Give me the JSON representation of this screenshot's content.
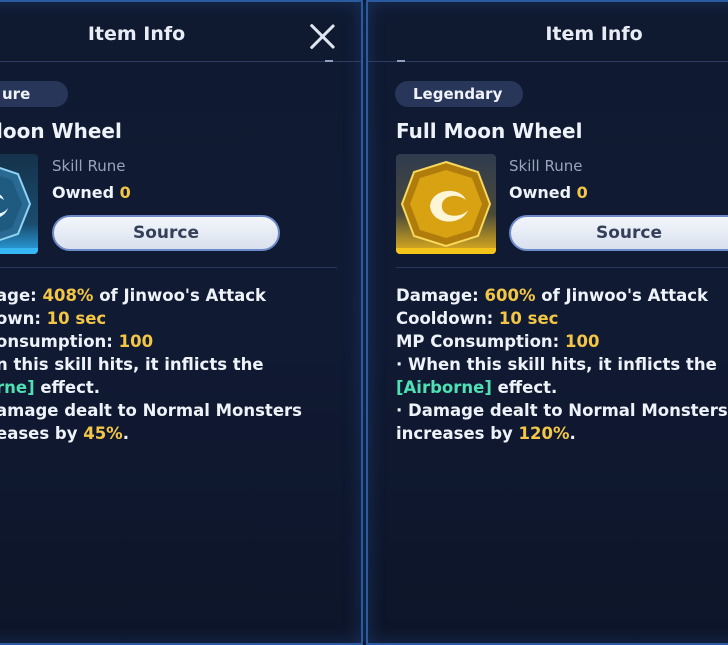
{
  "colors": {
    "highlight_yellow": "#f3c646",
    "highlight_green": "#4fe0b4",
    "panel_border": "#2a5aa0",
    "rare_icon": "#37b7f5",
    "legendary_icon": "#f3c419"
  },
  "left_panel": {
    "title": "Item Info",
    "close_icon": "close-icon",
    "grade": "ure",
    "name": "loon Wheel",
    "skill_type": "Skill Rune",
    "owned_label": "Owned",
    "owned_count": "0",
    "source_label": "Source",
    "desc": {
      "l1_a": "age: ",
      "l1_b": "408%",
      "l1_c": " of Jinwoo's Attack",
      "l2_a": "own: ",
      "l2_b": "10 sec",
      "l3_a": "onsumption: ",
      "l3_b": "100",
      "l4": "n this skill hits, it inflicts the",
      "l5_a": "rne]",
      "l5_b": " effect.",
      "l6": "amage dealt to Normal Monsters",
      "l7_a": "eases by ",
      "l7_b": "45%",
      "l7_c": "."
    }
  },
  "right_panel": {
    "title": "Item Info",
    "grade": "Legendary",
    "name": "Full Moon Wheel",
    "skill_type": "Skill Rune",
    "owned_label": "Owned",
    "owned_count": "0",
    "source_label": "Source",
    "desc": {
      "l1_a": "Damage: ",
      "l1_b": "600%",
      "l1_c": " of Jinwoo's Attack",
      "l2_a": "Cooldown: ",
      "l2_b": "10 sec",
      "l3_a": "MP Consumption: ",
      "l3_b": "100",
      "l4": " · When this skill hits, it inflicts the",
      "l5_a": "[Airborne]",
      "l5_b": " effect.",
      "l6": " · Damage dealt to Normal Monsters",
      "l7_a": "increases by ",
      "l7_b": "120%",
      "l7_c": "."
    }
  }
}
